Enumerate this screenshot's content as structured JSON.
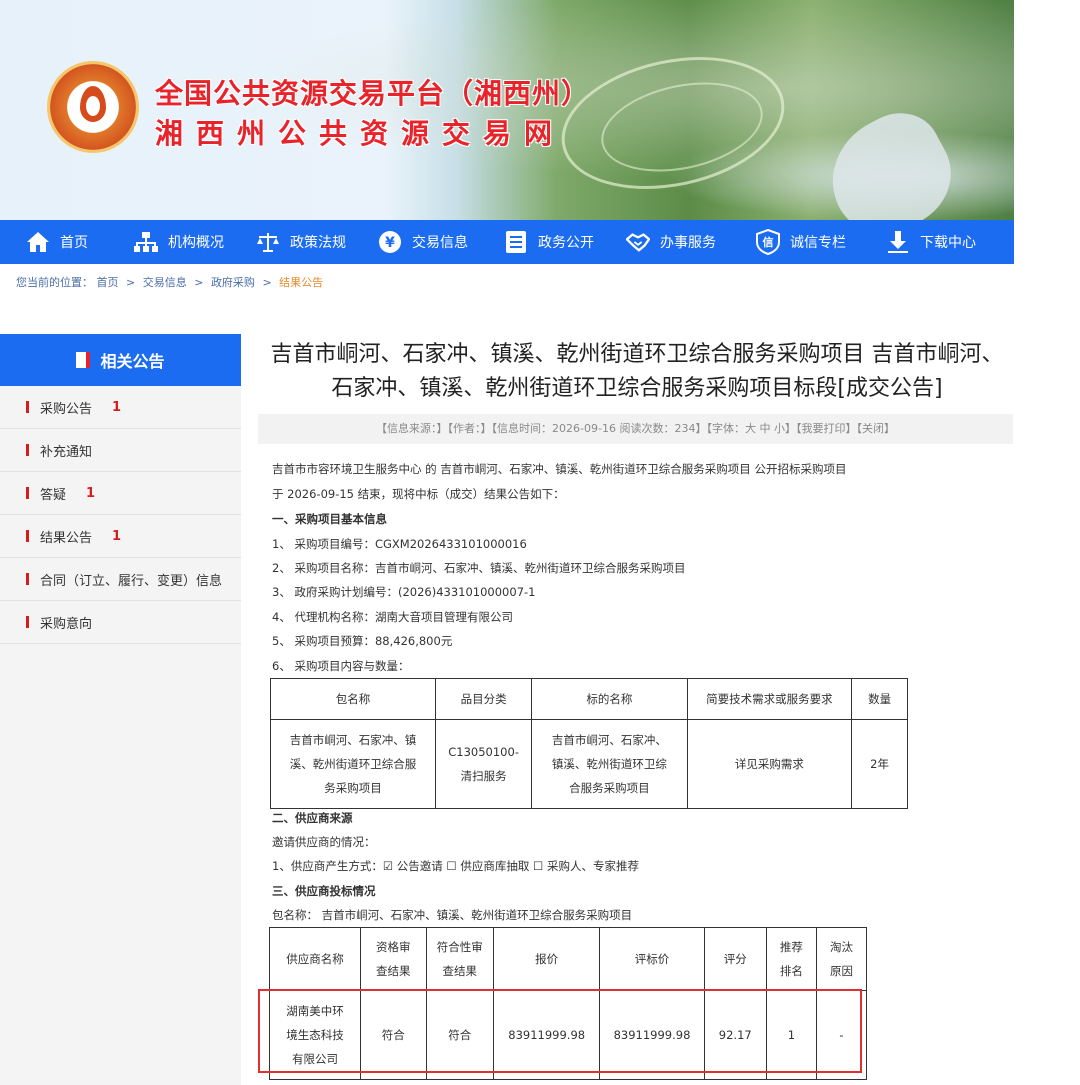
{
  "site": {
    "title_line1": "全国公共资源交易平台（湘西州）",
    "title_line2": "湘西州公共资源交易网"
  },
  "nav": [
    {
      "label": "首页",
      "icon": "home-icon"
    },
    {
      "label": "机构概况",
      "icon": "org-chart-icon"
    },
    {
      "label": "政策法规",
      "icon": "scales-icon"
    },
    {
      "label": "交易信息",
      "icon": "yen-icon"
    },
    {
      "label": "政务公开",
      "icon": "document-icon"
    },
    {
      "label": "办事服务",
      "icon": "handshake-icon"
    },
    {
      "label": "诚信专栏",
      "icon": "credit-icon"
    },
    {
      "label": "下载中心",
      "icon": "download-icon"
    }
  ],
  "breadcrumb": {
    "prefix": "您当前的位置：",
    "items": [
      "首页",
      "交易信息",
      "政府采购"
    ],
    "current": "结果公告",
    "sep": ">"
  },
  "sidebar": {
    "title": "相关公告",
    "items": [
      {
        "label": "采购公告",
        "count": "1"
      },
      {
        "label": "补充通知",
        "count": ""
      },
      {
        "label": "答疑",
        "count": "1"
      },
      {
        "label": "结果公告",
        "count": "1"
      },
      {
        "label": "合同（订立、履行、变更）信息",
        "count": ""
      },
      {
        "label": "采购意向",
        "count": ""
      }
    ]
  },
  "article": {
    "title": "吉首市峒河、石家冲、镇溪、乾州街道环卫综合服务采购项目 吉首市峒河、石家冲、镇溪、乾州街道环卫综合服务采购项目标段[成交公告]",
    "meta": "【信息来源：】【作者：】【信息时间：2026-09-16 阅读次数：234】【字体：大 中 小】【我要打印】【关闭】",
    "intro1": "吉首市市容环境卫生服务中心 的 吉首市峒河、石家冲、镇溪、乾州街道环卫综合服务采购项目 公开招标采购项目",
    "intro2": "于 2026-09-15 结束，现将中标（成交）结果公告如下：",
    "sec1": "一、采购项目基本信息",
    "info": [
      "1、  采购项目编号：CGXM2026433101000016",
      "2、  采购项目名称：吉首市峒河、石家冲、镇溪、乾州街道环卫综合服务采购项目",
      "3、  政府采购计划编号：(2026)433101000007-1",
      "4、  代理机构名称：湖南大音项目管理有限公司",
      "5、  采购项目预算：88,426,800元",
      "6、  采购项目内容与数量："
    ],
    "table1": {
      "headers": [
        "包名称",
        "品目分类",
        "标的名称",
        "简要技术需求或服务要求",
        "数量"
      ],
      "row": {
        "pkg": [
          "吉首市峒河、石家冲、镇",
          "溪、乾州街道环卫综合服",
          "务采购项目"
        ],
        "cat": [
          "C13050100-",
          "清扫服务"
        ],
        "target": [
          "吉首市峒河、石家冲、",
          "镇溪、乾州街道环卫综",
          "合服务采购项目"
        ],
        "req": "详见采购需求",
        "qty": "2年"
      }
    },
    "sec2": "二、供应商来源",
    "invite": "邀请供应商的情况：",
    "method": "1、供应商产生方式：☑ 公告邀请 ☐ 供应商库抽取 ☐ 采购人、专家推荐",
    "sec3": "三、供应商投标情况",
    "pkgname": "包名称： 吉首市峒河、石家冲、镇溪、乾州街道环卫综合服务采购项目",
    "table2": {
      "headers": [
        [
          "供应商名称"
        ],
        [
          "资格审",
          "查结果"
        ],
        [
          "符合性审",
          "查结果"
        ],
        [
          "报价"
        ],
        [
          "评标价"
        ],
        [
          "评分"
        ],
        [
          "推荐",
          "排名"
        ],
        [
          "淘汰",
          "原因"
        ]
      ],
      "row": {
        "name": [
          "湖南美中环",
          "境生态科技",
          "有限公司"
        ],
        "qual": "符合",
        "conf": "符合",
        "price": "83911999.98",
        "eval": "83911999.98",
        "score": "92.17",
        "rank": "1",
        "reason": "-"
      }
    }
  }
}
